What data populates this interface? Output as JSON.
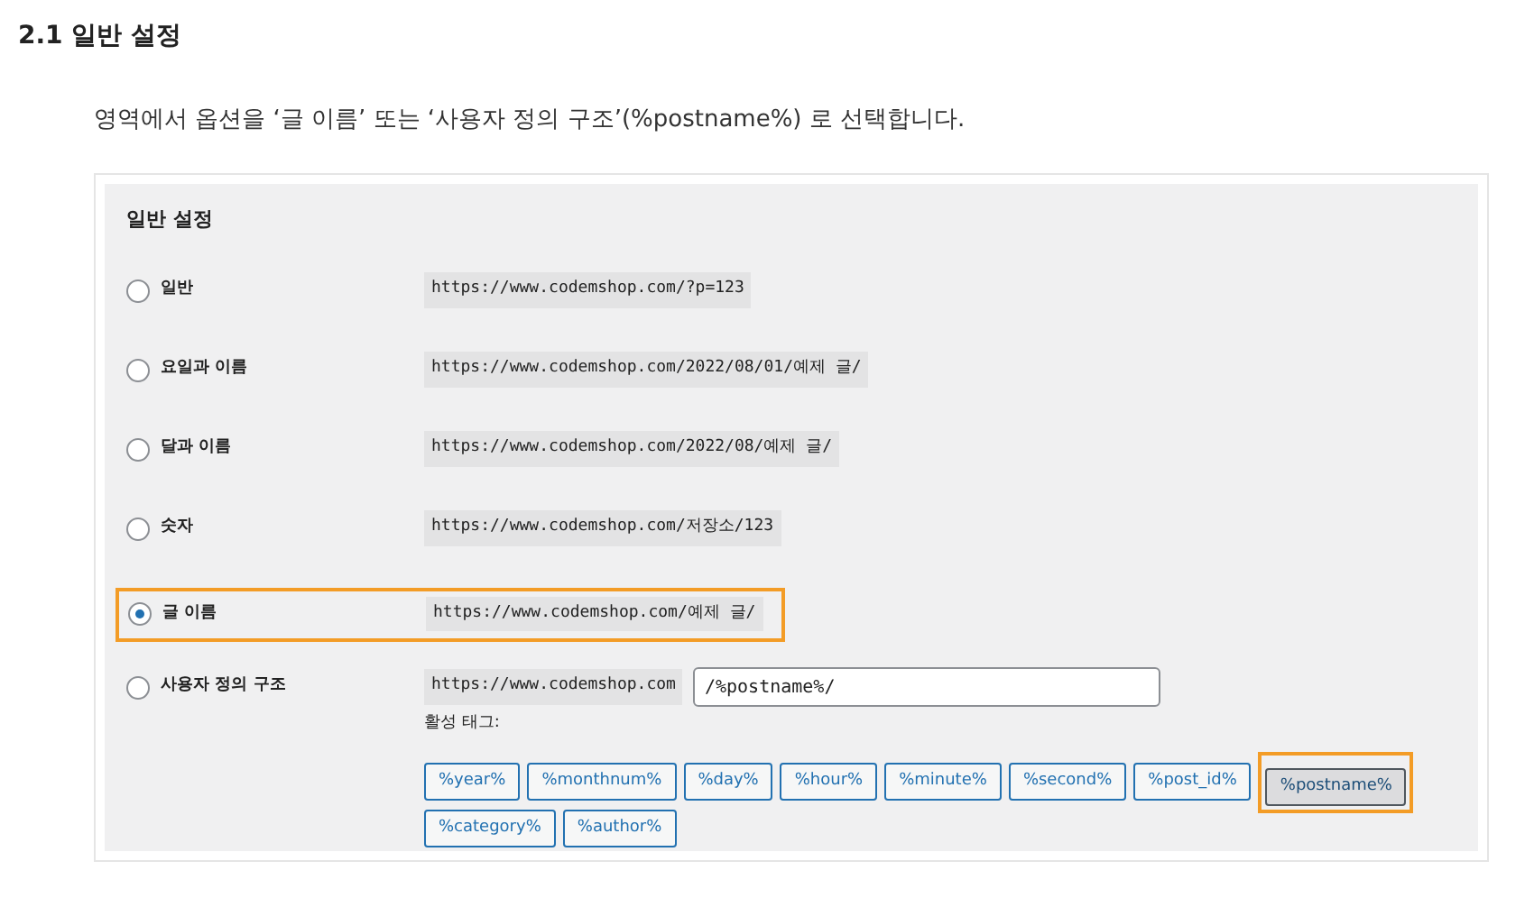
{
  "heading": "2.1 일반 설정",
  "instruction": "영역에서 옵션을 ‘글 이름’ 또는 ‘사용자 정의 구조’(%postname%) 로 선택합니다.",
  "settings": {
    "title": "일반 설정",
    "options": [
      {
        "label": "일반",
        "url": "https://www.codemshop.com/?p=123",
        "selected": false,
        "kind": "preset"
      },
      {
        "label": "요일과 이름",
        "url": "https://www.codemshop.com/2022/08/01/예제 글/",
        "selected": false,
        "kind": "preset"
      },
      {
        "label": "달과 이름",
        "url": "https://www.codemshop.com/2022/08/예제 글/",
        "selected": false,
        "kind": "preset"
      },
      {
        "label": "숫자",
        "url": "https://www.codemshop.com/저장소/123",
        "selected": false,
        "kind": "preset"
      },
      {
        "label": "글 이름",
        "url": "https://www.codemshop.com/예제 글/",
        "selected": true,
        "kind": "preset"
      },
      {
        "label": "사용자 정의 구조",
        "url": "https://www.codemshop.com",
        "value": "/%postname%/",
        "selected": false,
        "kind": "custom"
      }
    ],
    "tags_label": "활성 태그:",
    "tags": [
      {
        "label": "%year%",
        "selected": false
      },
      {
        "label": "%monthnum%",
        "selected": false
      },
      {
        "label": "%day%",
        "selected": false
      },
      {
        "label": "%hour%",
        "selected": false
      },
      {
        "label": "%minute%",
        "selected": false
      },
      {
        "label": "%second%",
        "selected": false
      },
      {
        "label": "%post_id%",
        "selected": false
      },
      {
        "label": "%postname%",
        "selected": true
      },
      {
        "label": "%category%",
        "selected": false
      },
      {
        "label": "%author%",
        "selected": false
      }
    ]
  }
}
